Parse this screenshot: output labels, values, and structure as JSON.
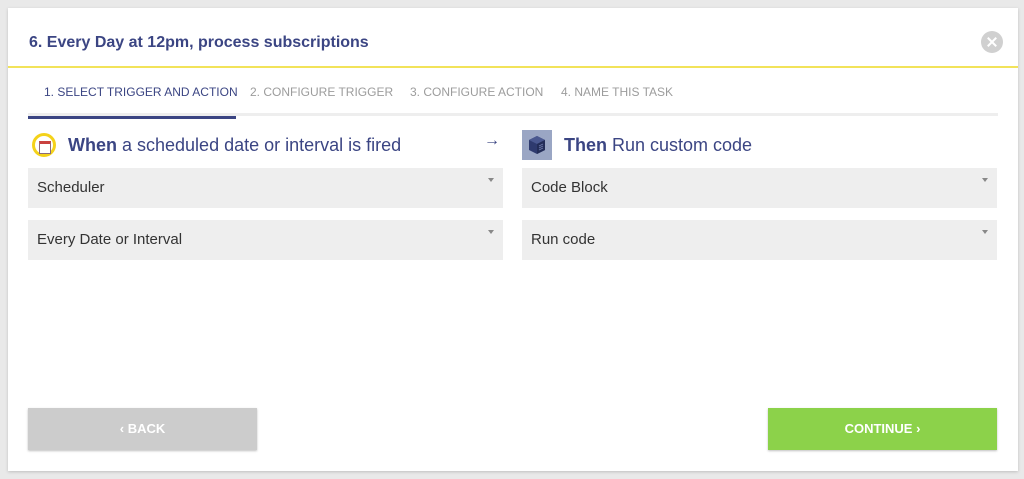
{
  "modal": {
    "title": "6. Every Day at 12pm, process subscriptions",
    "close_icon": "close-icon"
  },
  "tabs": [
    {
      "label": "1. Select trigger and action",
      "active": true
    },
    {
      "label": "2. Configure trigger",
      "active": false
    },
    {
      "label": "3. Configure action",
      "active": false
    },
    {
      "label": "4. Name this task",
      "active": false
    }
  ],
  "trigger": {
    "icon": "calendar-icon",
    "heading_strong": "When",
    "heading_rest": "a scheduled date or interval is fired",
    "app_select": "Scheduler",
    "event_select": "Every Date or Interval"
  },
  "arrow": "→",
  "action": {
    "icon": "code-block-icon",
    "heading_strong": "Then",
    "heading_rest": "Run custom code",
    "app_select": "Code Block",
    "event_select": "Run code"
  },
  "buttons": {
    "back_label": "‹ BACK",
    "continue_label": "CONTINUE ›"
  },
  "colors": {
    "accent_navy": "#3b4583",
    "header_rule": "#f2e35a",
    "continue_green": "#8cd24a",
    "back_gray": "#cccccc"
  }
}
